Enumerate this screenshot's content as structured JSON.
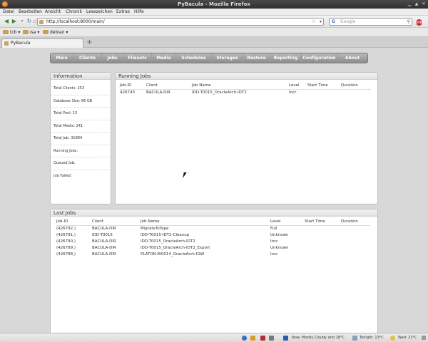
{
  "window": {
    "title": "PyBacula - Mozilla Firefox"
  },
  "menu": [
    "Datei",
    "Bearbeiten",
    "Ansicht",
    "Chronik",
    "Lesezeichen",
    "Extras",
    "Hilfe"
  ],
  "nav": {
    "url": "http://localhost:8000/main/",
    "search_placeholder": "Google"
  },
  "bookmarks": [
    "tcb",
    "isa",
    "debian"
  ],
  "tab": {
    "label": "PyBacula"
  },
  "app_nav": [
    "Main",
    "Clients",
    "Jobs",
    "Filesets",
    "Media",
    "Schedules",
    "Storages",
    "Restore",
    "Reporting",
    "Configuration",
    "About"
  ],
  "information": {
    "title": "Information",
    "rows": [
      "Total Clients: 253",
      "Database Size: 86 GB",
      "Total Pool: 15",
      "Total Media: 241",
      "Total Job: 31884",
      "Running Jobs:",
      "Queued Job:",
      "Job Failed:"
    ]
  },
  "running_jobs": {
    "title": "Running Jobs",
    "columns": [
      "Job-ID",
      "Client",
      "Job Name",
      "Level",
      "Start Time",
      "Duration"
    ],
    "rows": [
      [
        "426743",
        "BACULA-DIR",
        "IDD-T0015_OracleArch-IDT2",
        "Incr",
        "",
        ""
      ]
    ]
  },
  "last_jobs": {
    "title": "Last Jobs",
    "columns": [
      "Job-ID",
      "Client",
      "Job Name",
      "Level",
      "Start Time",
      "Duration"
    ],
    "rows": [
      [
        "(426792,)",
        "BACULA-DIR",
        "MigrateToTape",
        "Full",
        "",
        ""
      ],
      [
        "(426791,)",
        "IDD-T0015",
        "IDD-T0015-IDT2-Cleanup",
        "Unknown",
        "",
        ""
      ],
      [
        "(426790,)",
        "BACULA-DIR",
        "IDD-T0015_OracleArch-IDT2",
        "Incr",
        "",
        ""
      ],
      [
        "(426789,)",
        "BACULA-DIR",
        "IDD-T0015_OracleArch-IDT2_Export",
        "Unknown",
        "",
        ""
      ],
      [
        "(426788,)",
        "BACULA-DIR",
        "PLATON-W0014_OracleArch-IDW",
        "Incr",
        "",
        ""
      ]
    ]
  },
  "status": {
    "weather_now": "Now: Mostly Cloudy and 18°C",
    "tonight": "Tonight: 13°C",
    "wed": "Wed: 23°C"
  },
  "colors": {
    "nav_bar": "#9e9e9e",
    "panel_header": "#e8e8e8"
  }
}
